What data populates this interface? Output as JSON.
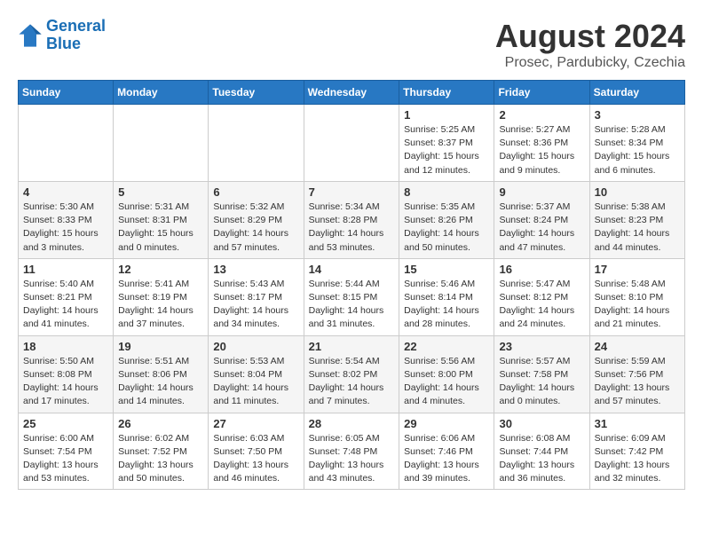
{
  "header": {
    "logo_line1": "General",
    "logo_line2": "Blue",
    "month_title": "August 2024",
    "location": "Prosec, Pardubicky, Czechia"
  },
  "weekdays": [
    "Sunday",
    "Monday",
    "Tuesday",
    "Wednesday",
    "Thursday",
    "Friday",
    "Saturday"
  ],
  "weeks": [
    [
      {
        "day": "",
        "info": ""
      },
      {
        "day": "",
        "info": ""
      },
      {
        "day": "",
        "info": ""
      },
      {
        "day": "",
        "info": ""
      },
      {
        "day": "1",
        "info": "Sunrise: 5:25 AM\nSunset: 8:37 PM\nDaylight: 15 hours\nand 12 minutes."
      },
      {
        "day": "2",
        "info": "Sunrise: 5:27 AM\nSunset: 8:36 PM\nDaylight: 15 hours\nand 9 minutes."
      },
      {
        "day": "3",
        "info": "Sunrise: 5:28 AM\nSunset: 8:34 PM\nDaylight: 15 hours\nand 6 minutes."
      }
    ],
    [
      {
        "day": "4",
        "info": "Sunrise: 5:30 AM\nSunset: 8:33 PM\nDaylight: 15 hours\nand 3 minutes."
      },
      {
        "day": "5",
        "info": "Sunrise: 5:31 AM\nSunset: 8:31 PM\nDaylight: 15 hours\nand 0 minutes."
      },
      {
        "day": "6",
        "info": "Sunrise: 5:32 AM\nSunset: 8:29 PM\nDaylight: 14 hours\nand 57 minutes."
      },
      {
        "day": "7",
        "info": "Sunrise: 5:34 AM\nSunset: 8:28 PM\nDaylight: 14 hours\nand 53 minutes."
      },
      {
        "day": "8",
        "info": "Sunrise: 5:35 AM\nSunset: 8:26 PM\nDaylight: 14 hours\nand 50 minutes."
      },
      {
        "day": "9",
        "info": "Sunrise: 5:37 AM\nSunset: 8:24 PM\nDaylight: 14 hours\nand 47 minutes."
      },
      {
        "day": "10",
        "info": "Sunrise: 5:38 AM\nSunset: 8:23 PM\nDaylight: 14 hours\nand 44 minutes."
      }
    ],
    [
      {
        "day": "11",
        "info": "Sunrise: 5:40 AM\nSunset: 8:21 PM\nDaylight: 14 hours\nand 41 minutes."
      },
      {
        "day": "12",
        "info": "Sunrise: 5:41 AM\nSunset: 8:19 PM\nDaylight: 14 hours\nand 37 minutes."
      },
      {
        "day": "13",
        "info": "Sunrise: 5:43 AM\nSunset: 8:17 PM\nDaylight: 14 hours\nand 34 minutes."
      },
      {
        "day": "14",
        "info": "Sunrise: 5:44 AM\nSunset: 8:15 PM\nDaylight: 14 hours\nand 31 minutes."
      },
      {
        "day": "15",
        "info": "Sunrise: 5:46 AM\nSunset: 8:14 PM\nDaylight: 14 hours\nand 28 minutes."
      },
      {
        "day": "16",
        "info": "Sunrise: 5:47 AM\nSunset: 8:12 PM\nDaylight: 14 hours\nand 24 minutes."
      },
      {
        "day": "17",
        "info": "Sunrise: 5:48 AM\nSunset: 8:10 PM\nDaylight: 14 hours\nand 21 minutes."
      }
    ],
    [
      {
        "day": "18",
        "info": "Sunrise: 5:50 AM\nSunset: 8:08 PM\nDaylight: 14 hours\nand 17 minutes."
      },
      {
        "day": "19",
        "info": "Sunrise: 5:51 AM\nSunset: 8:06 PM\nDaylight: 14 hours\nand 14 minutes."
      },
      {
        "day": "20",
        "info": "Sunrise: 5:53 AM\nSunset: 8:04 PM\nDaylight: 14 hours\nand 11 minutes."
      },
      {
        "day": "21",
        "info": "Sunrise: 5:54 AM\nSunset: 8:02 PM\nDaylight: 14 hours\nand 7 minutes."
      },
      {
        "day": "22",
        "info": "Sunrise: 5:56 AM\nSunset: 8:00 PM\nDaylight: 14 hours\nand 4 minutes."
      },
      {
        "day": "23",
        "info": "Sunrise: 5:57 AM\nSunset: 7:58 PM\nDaylight: 14 hours\nand 0 minutes."
      },
      {
        "day": "24",
        "info": "Sunrise: 5:59 AM\nSunset: 7:56 PM\nDaylight: 13 hours\nand 57 minutes."
      }
    ],
    [
      {
        "day": "25",
        "info": "Sunrise: 6:00 AM\nSunset: 7:54 PM\nDaylight: 13 hours\nand 53 minutes."
      },
      {
        "day": "26",
        "info": "Sunrise: 6:02 AM\nSunset: 7:52 PM\nDaylight: 13 hours\nand 50 minutes."
      },
      {
        "day": "27",
        "info": "Sunrise: 6:03 AM\nSunset: 7:50 PM\nDaylight: 13 hours\nand 46 minutes."
      },
      {
        "day": "28",
        "info": "Sunrise: 6:05 AM\nSunset: 7:48 PM\nDaylight: 13 hours\nand 43 minutes."
      },
      {
        "day": "29",
        "info": "Sunrise: 6:06 AM\nSunset: 7:46 PM\nDaylight: 13 hours\nand 39 minutes."
      },
      {
        "day": "30",
        "info": "Sunrise: 6:08 AM\nSunset: 7:44 PM\nDaylight: 13 hours\nand 36 minutes."
      },
      {
        "day": "31",
        "info": "Sunrise: 6:09 AM\nSunset: 7:42 PM\nDaylight: 13 hours\nand 32 minutes."
      }
    ]
  ]
}
